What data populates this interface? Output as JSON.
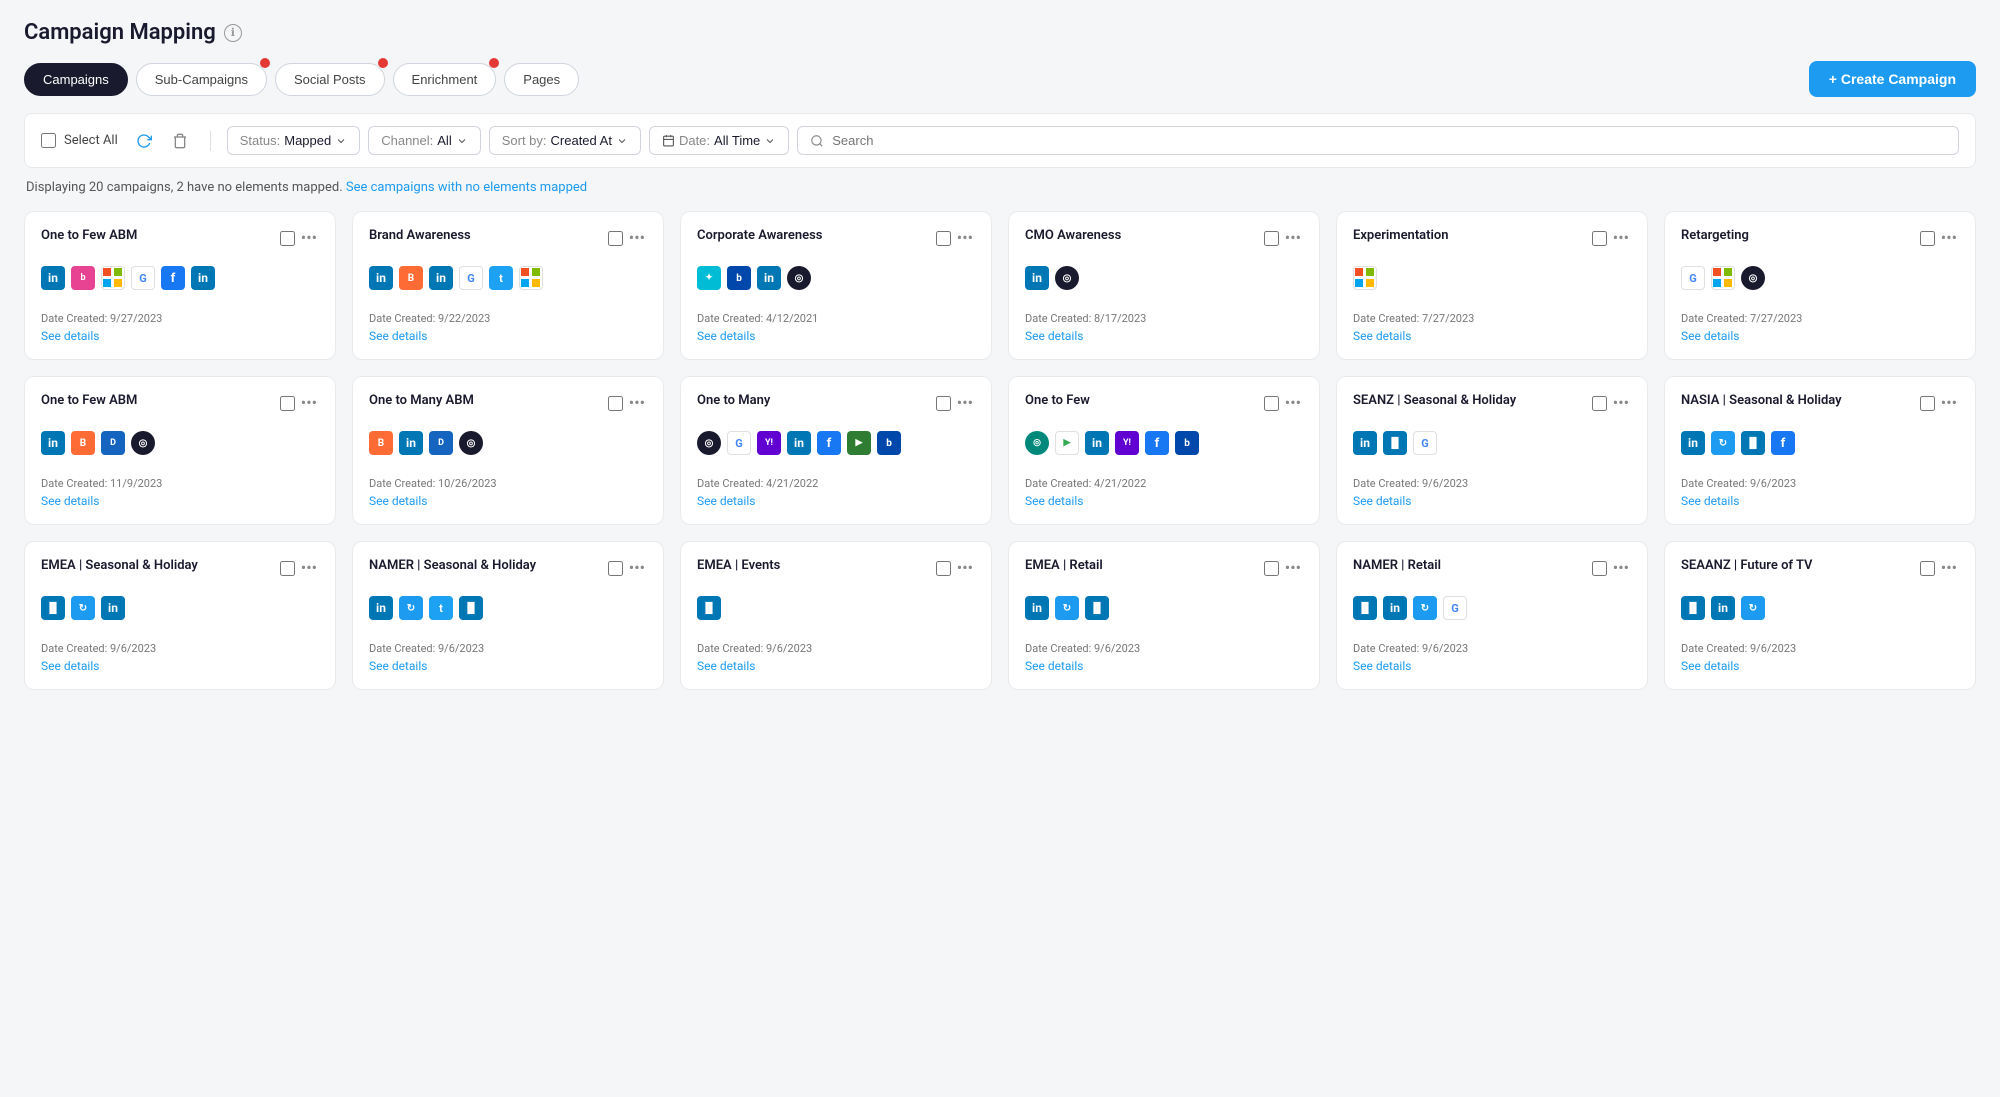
{
  "page": {
    "title": "Campaign Mapping",
    "info_icon": "ℹ"
  },
  "tabs": [
    {
      "id": "campaigns",
      "label": "Campaigns",
      "active": true,
      "badge": false
    },
    {
      "id": "sub-campaigns",
      "label": "Sub-Campaigns",
      "active": false,
      "badge": true
    },
    {
      "id": "social-posts",
      "label": "Social Posts",
      "active": false,
      "badge": true
    },
    {
      "id": "enrichment",
      "label": "Enrichment",
      "active": false,
      "badge": true
    },
    {
      "id": "pages",
      "label": "Pages",
      "active": false,
      "badge": false
    }
  ],
  "create_button": "+ Create Campaign",
  "toolbar": {
    "select_all": "Select All",
    "filters": {
      "status": {
        "label": "Status:",
        "value": "Mapped"
      },
      "channel": {
        "label": "Channel:",
        "value": "All"
      },
      "sort": {
        "label": "Sort by:",
        "value": "Created At"
      },
      "date": {
        "label": "Date:",
        "value": "All Time"
      }
    },
    "search_placeholder": "Search"
  },
  "info_bar": {
    "text": "Displaying 20 campaigns, 2 have no elements mapped.",
    "link_text": "See campaigns with no elements mapped"
  },
  "campaigns": [
    {
      "id": 1,
      "title": "One to Few ABM",
      "date": "Date Created: 9/27/2023",
      "icons": [
        "linkedin",
        "bombora",
        "microsoft",
        "google",
        "facebook",
        "linkedin2"
      ]
    },
    {
      "id": 2,
      "title": "Brand Awareness",
      "date": "Date Created: 9/22/2023",
      "icons": [
        "linkedin",
        "bombora",
        "linkedin2",
        "google",
        "twitter",
        "microsoft"
      ]
    },
    {
      "id": 3,
      "title": "Corporate Awareness",
      "date": "Date Created: 4/12/2021",
      "icons": [
        "outreach",
        "bombora2",
        "linkedin",
        "circle"
      ]
    },
    {
      "id": 4,
      "title": "CMO Awareness",
      "date": "Date Created: 8/17/2023",
      "icons": [
        "linkedin",
        "circle"
      ]
    },
    {
      "id": 5,
      "title": "Experimentation",
      "date": "Date Created: 7/27/2023",
      "icons": [
        "microsoft"
      ]
    },
    {
      "id": 6,
      "title": "Retargeting",
      "date": "Date Created: 7/27/2023",
      "icons": [
        "google",
        "microsoft",
        "circle"
      ]
    },
    {
      "id": 7,
      "title": "One to Few ABM",
      "date": "Date Created: 11/9/2023",
      "icons": [
        "linkedin",
        "bombora",
        "dv360",
        "circle"
      ]
    },
    {
      "id": 8,
      "title": "One to Many ABM",
      "date": "Date Created: 10/26/2023",
      "icons": [
        "bombora",
        "linkedin",
        "dv360",
        "circle"
      ]
    },
    {
      "id": 9,
      "title": "One to Many",
      "date": "Date Created: 4/21/2022",
      "icons": [
        "circle",
        "google",
        "yahoo",
        "linkedin",
        "facebook",
        "display",
        "bombora2"
      ]
    },
    {
      "id": 10,
      "title": "One to Few",
      "date": "Date Created: 4/21/2022",
      "icons": [
        "programmatic",
        "google2",
        "linkedin",
        "yahoo",
        "facebook",
        "bombora2"
      ]
    },
    {
      "id": 11,
      "title": "SEANZ | Seasonal & Holiday",
      "date": "Date Created: 9/6/2023",
      "icons": [
        "linkedin",
        "bar",
        "google"
      ]
    },
    {
      "id": 12,
      "title": "NASIA | Seasonal & Holiday",
      "date": "Date Created: 9/6/2023",
      "icons": [
        "linkedin",
        "refresh",
        "bar",
        "facebook"
      ]
    },
    {
      "id": 13,
      "title": "EMEA | Seasonal & Holiday",
      "date": "Date Created: 9/6/2023",
      "icons": [
        "bar",
        "refresh",
        "linkedin"
      ]
    },
    {
      "id": 14,
      "title": "NAMER | Seasonal & Holiday",
      "date": "Date Created: 9/6/2023",
      "icons": [
        "linkedin",
        "refresh",
        "twitter",
        "bar"
      ]
    },
    {
      "id": 15,
      "title": "EMEA | Events",
      "date": "Date Created: 9/6/2023",
      "icons": [
        "bar2"
      ]
    },
    {
      "id": 16,
      "title": "EMEA | Retail",
      "date": "Date Created: 9/6/2023",
      "icons": [
        "linkedin",
        "refresh",
        "bar"
      ]
    },
    {
      "id": 17,
      "title": "NAMER | Retail",
      "date": "Date Created: 9/6/2023",
      "icons": [
        "bar",
        "linkedin",
        "refresh",
        "google"
      ]
    },
    {
      "id": 18,
      "title": "SEAANZ | Future of TV",
      "date": "Date Created: 9/6/2023",
      "icons": [
        "bar",
        "linkedin",
        "refresh"
      ]
    }
  ]
}
